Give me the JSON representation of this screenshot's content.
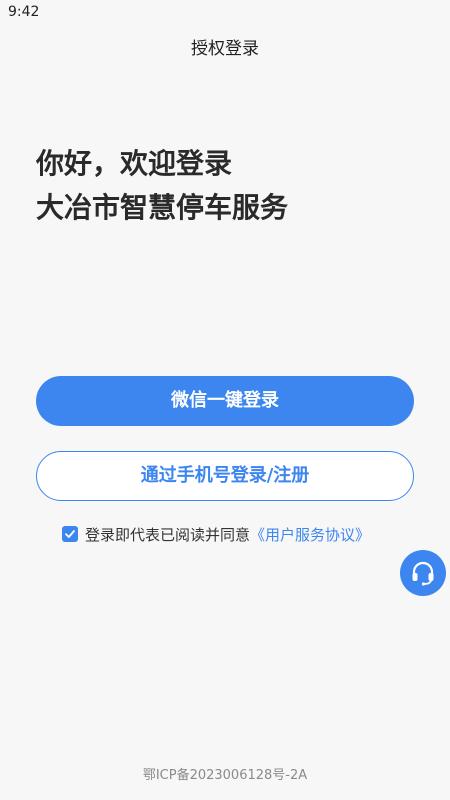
{
  "status_bar": {
    "time": "9:42"
  },
  "header": {
    "title": "授权登录"
  },
  "greeting": {
    "line1": "你好，欢迎登录",
    "line2": "大冶市智慧停车服务"
  },
  "buttons": {
    "wechat_login": "微信一键登录",
    "phone_login": "通过手机号登录/注册"
  },
  "agreement": {
    "checked": true,
    "text": "登录即代表已阅读并同意",
    "link": "《用户服务协议》"
  },
  "footer": {
    "icp": "鄂ICP备2023006128号-2A"
  },
  "icons": {
    "checkbox": "check-icon",
    "support": "headset-icon"
  },
  "colors": {
    "accent": "#3d86f0",
    "background": "#f7f7f7",
    "footer_text": "#8a8a8a"
  }
}
